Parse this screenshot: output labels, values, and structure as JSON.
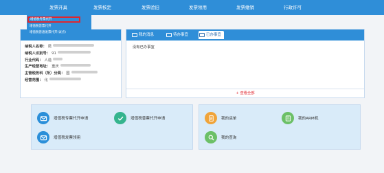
{
  "nav": {
    "items": [
      "发票开具",
      "发票核定",
      "发票验旧",
      "发票领用",
      "发票缴销",
      "行政许可"
    ],
    "dropdown": {
      "highlighted": "增值税专票代开",
      "items": [
        "增值税普票代开",
        "增值税普通发票代开(试点)"
      ]
    }
  },
  "taxpayer": {
    "fields": [
      {
        "label": "纳税人名称：",
        "value": "昆"
      },
      {
        "label": "纳税人识别号：",
        "value": "91"
      },
      {
        "label": "行业代码：",
        "value": "人造"
      },
      {
        "label": "生产经营地址：",
        "value": "重庆"
      },
      {
        "label": "主管税务科（所）分局：",
        "value": "国"
      },
      {
        "label": "经营范围：",
        "value": "化"
      }
    ]
  },
  "tasks": {
    "tabs": [
      {
        "label": "我的消息"
      },
      {
        "label": "待办事宜"
      },
      {
        "label": "已办事宜"
      }
    ],
    "empty_text": "没有已办事宜",
    "more_label": "+ 查看全部"
  },
  "quick_links": {
    "left": [
      {
        "label": "增值税专票代开申请",
        "icon": "envelope-icon"
      },
      {
        "label": "增值税普票代开申请",
        "icon": "check-icon"
      },
      {
        "label": "增值税发票领用",
        "icon": "envelope-icon"
      }
    ],
    "right": [
      {
        "label": "我的运单",
        "icon": "document-icon"
      },
      {
        "label": "我的ARM机",
        "icon": "calculator-icon"
      },
      {
        "label": "我的查询",
        "icon": "search-icon"
      }
    ]
  }
}
